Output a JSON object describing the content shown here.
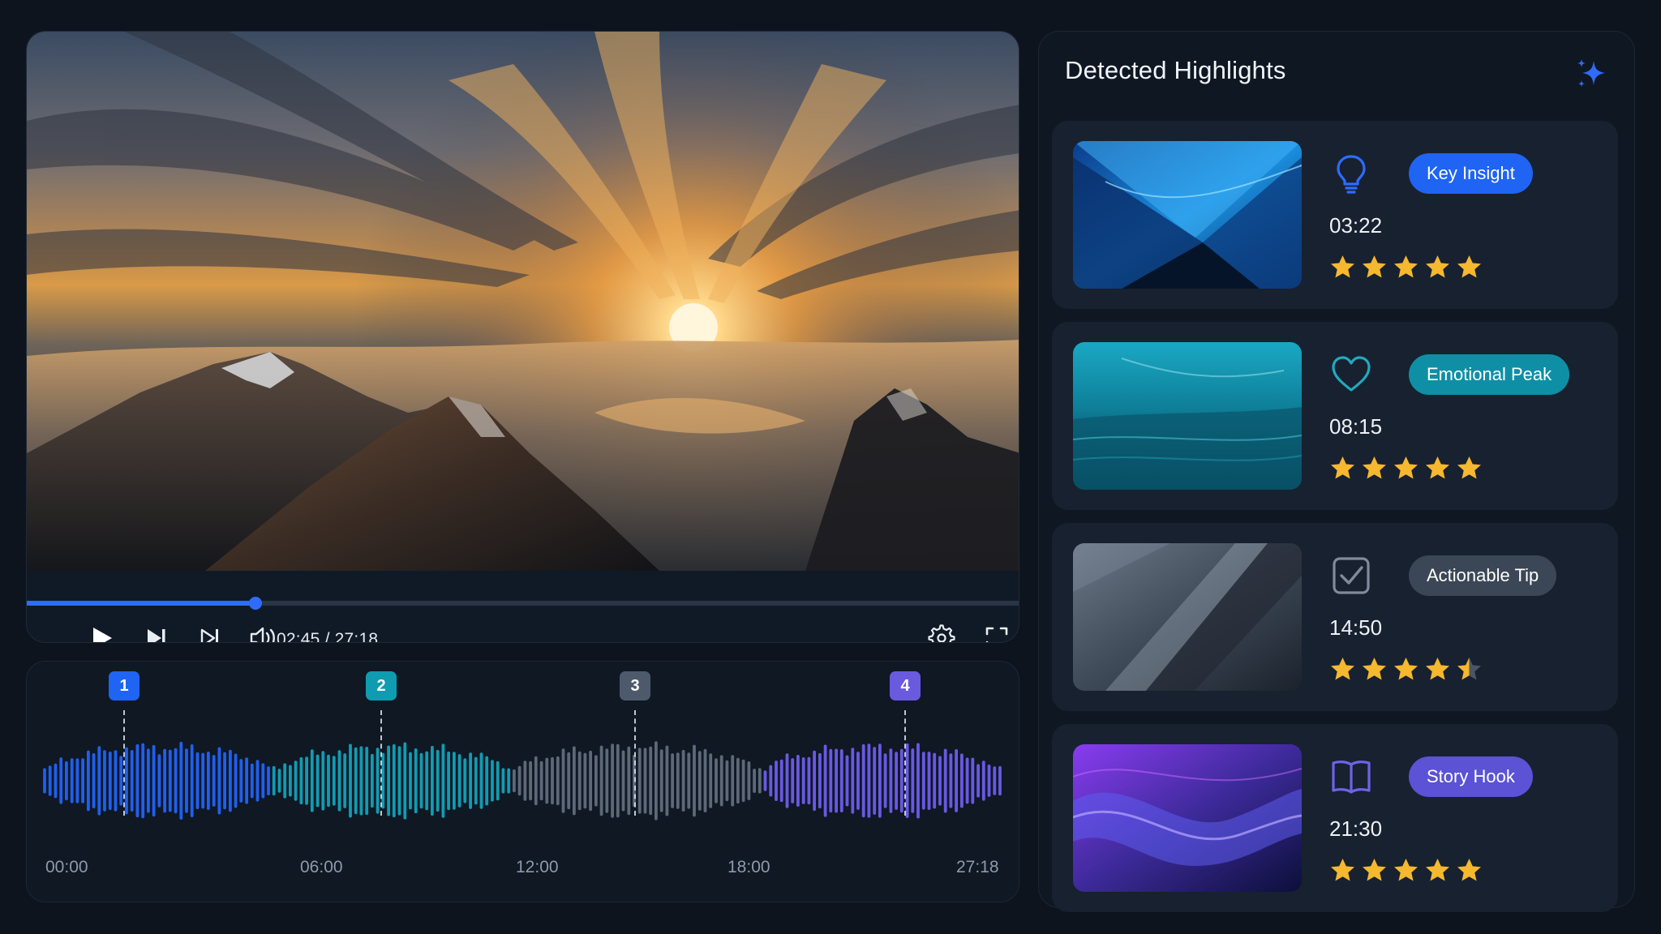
{
  "player": {
    "time_current": "02:45",
    "time_total": "27:18",
    "time_readout": "02:45 / 27:18",
    "progress_fraction": 0.23
  },
  "timeline": {
    "tick_labels": [
      "00:00",
      "06:00",
      "12:00",
      "18:00",
      "27:18"
    ],
    "markers": [
      {
        "label": "1",
        "color": "#1f64f2",
        "position_fraction": 0.098
      },
      {
        "label": "2",
        "color": "#0f9bb0",
        "position_fraction": 0.357
      },
      {
        "label": "3",
        "color": "#4d5a6c",
        "position_fraction": 0.612
      },
      {
        "label": "4",
        "color": "#6a5ae0",
        "position_fraction": 0.884
      }
    ],
    "segment_colors": [
      "#1f5ff0",
      "#0f9cb2",
      "#5d6878",
      "#6a58e4"
    ]
  },
  "highlights": {
    "title": "Detected Highlights",
    "items": [
      {
        "badge": "Key Insight",
        "time": "03:22",
        "rating": 5,
        "icon": "lightbulb-icon",
        "badge_color": "#1f64f2",
        "icon_color": "#2f6bff"
      },
      {
        "badge": "Emotional Peak",
        "time": "08:15",
        "rating": 5,
        "icon": "heart-icon",
        "badge_color": "#0f8fa6",
        "icon_color": "#22a9c0"
      },
      {
        "badge": "Actionable Tip",
        "time": "14:50",
        "rating": 4.5,
        "icon": "checkbox-icon",
        "badge_color": "#3b4656",
        "icon_color": "#7f8b9c"
      },
      {
        "badge": "Story Hook",
        "time": "21:30",
        "rating": 5,
        "icon": "book-icon",
        "badge_color": "#5b52d6",
        "icon_color": "#6e63e8"
      }
    ]
  },
  "colors": {
    "accent": "#2f6bff",
    "star": "#f5b82e",
    "background": "#0d141e"
  }
}
